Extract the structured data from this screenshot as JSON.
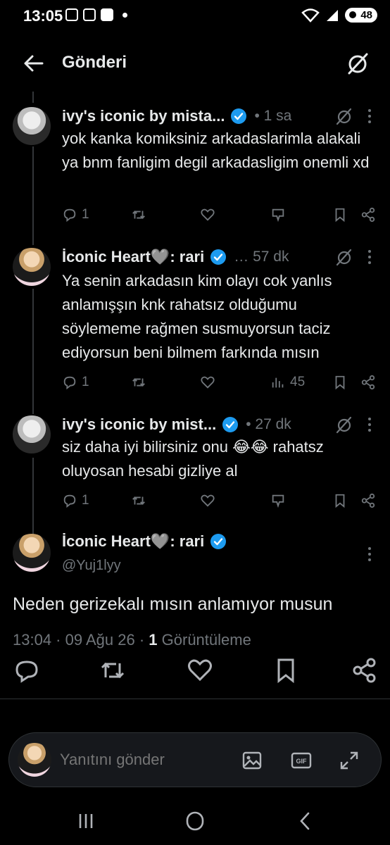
{
  "status_bar": {
    "time": "13:05",
    "battery": "48",
    "icons": [
      "gallery-icon",
      "photo-icon",
      "check-icon",
      "wifi-icon",
      "signal-icon",
      "battery-icon"
    ]
  },
  "header": {
    "title": "Gönderi",
    "back_icon": "arrow-left-icon",
    "action_icon": "grok-icon"
  },
  "tweets": [
    {
      "name": "ivy's iconic by mista...",
      "time": "• 1 sa",
      "text": "yok kanka komiksiniz arkadaslarimla alakali ya bnm fanligim degil arkadasligim onemli xd",
      "reply_count": "1",
      "views": ""
    },
    {
      "name": "İconic Heart🩶: rari",
      "time": "… 57 dk",
      "text": "Ya senin arkadasın kim olayı cok yanlıs anlamışşın knk rahatsız olduğumu söylememe rağmen susmuyorsun taciz ediyorsun beni bilmem farkında mısın",
      "reply_count": "1",
      "views": "45"
    },
    {
      "name": "ivy's iconic by mist...",
      "time": "• 27 dk",
      "text": "siz daha iyi bilirsiniz onu 😂😂 rahatsz oluyosan hesabi gizliye al",
      "reply_count": "1",
      "views": ""
    }
  ],
  "main_tweet": {
    "name": "İconic Heart🩶: rari",
    "handle": "@Yuj1lyy",
    "text": "Neden gerizekalı mısın anlamıyor musun",
    "timestamp": "13:04 · 09 Ağu 26 ·",
    "view_count": "1",
    "view_label": "Görüntüleme"
  },
  "reply_bar": {
    "placeholder": "Yanıtını gönder"
  },
  "colors": {
    "background": "#000000",
    "text": "#e7e9ea",
    "muted": "#71767b",
    "verified": "#1d9bf0",
    "divider": "#2f3336"
  }
}
